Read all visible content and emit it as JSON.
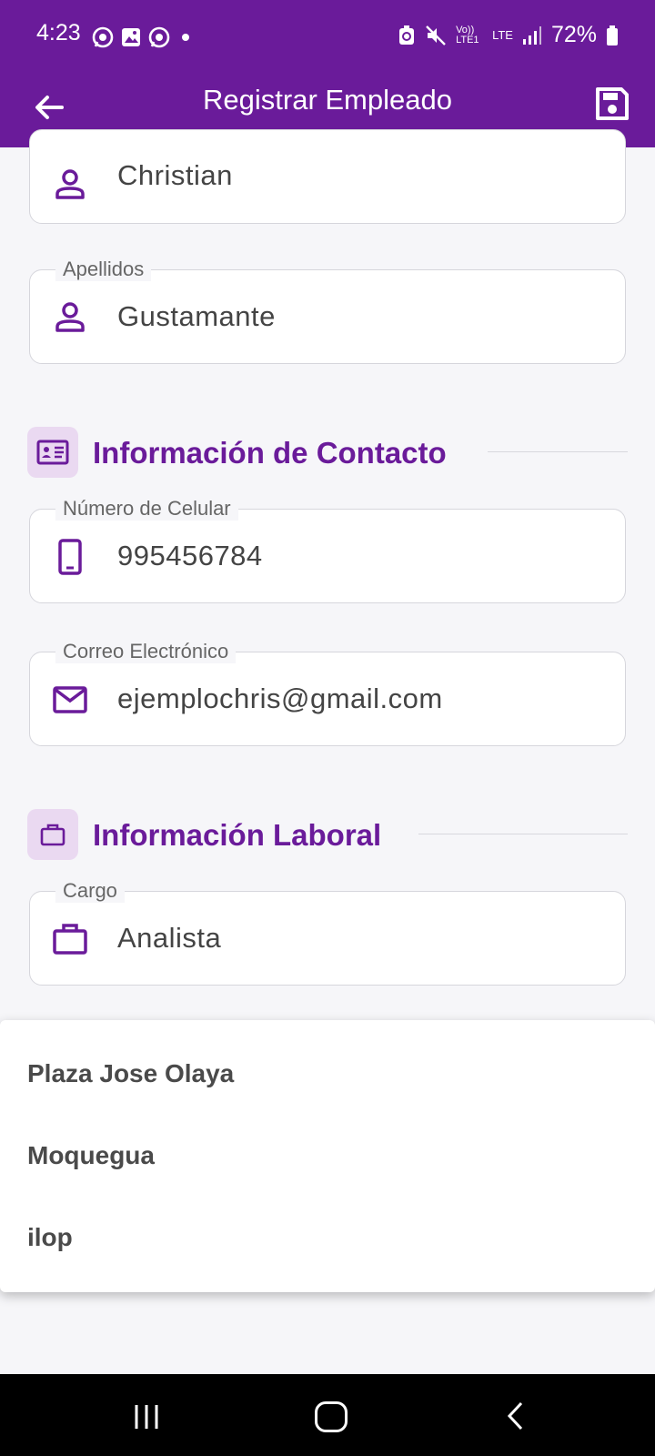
{
  "status_bar": {
    "time": "4:23",
    "battery": "72%",
    "network_label_1": "Vo)) LTE1",
    "network_label_2": "LTE",
    "icons": [
      "whatsapp-icon",
      "gallery-icon",
      "whatsapp-icon",
      "dot-icon",
      "battery-saver-icon",
      "mute-icon",
      "signal-icon",
      "battery-icon"
    ]
  },
  "app_bar": {
    "title": "Registrar Empleado",
    "back_icon": "arrow-left-icon",
    "save_icon": "save-icon"
  },
  "form": {
    "nombres": {
      "value": "Christian",
      "icon": "person-icon"
    },
    "apellidos": {
      "label": "Apellidos",
      "value": "Gustamante",
      "icon": "person-icon"
    },
    "contacto_section": {
      "title": "Información de Contacto",
      "icon": "contact-card-icon"
    },
    "celular": {
      "label": "Número de Celular",
      "value": "995456784",
      "icon": "phone-icon"
    },
    "correo": {
      "label": "Correo Electrónico",
      "value": "ejemplochris@gmail.com",
      "icon": "mail-icon"
    },
    "laboral_section": {
      "title": "Información Laboral",
      "icon": "briefcase-icon"
    },
    "cargo": {
      "label": "Cargo",
      "value": "Analista",
      "icon": "briefcase-icon"
    }
  },
  "dropdown": {
    "options": [
      "Plaza Jose Olaya",
      "Moquegua",
      "ilop"
    ]
  },
  "colors": {
    "primary": "#6a1b9a",
    "background": "#f6f6f9",
    "section_icon_bg": "#ead9f1"
  }
}
